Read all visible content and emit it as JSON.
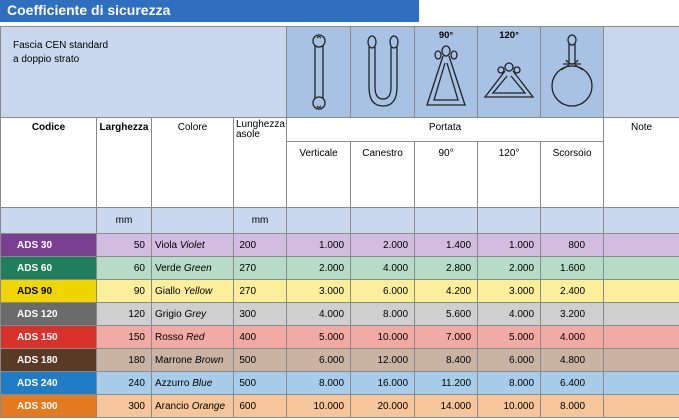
{
  "title": "Coefficiente di sicurezza",
  "headline": [
    "Fascia CEN standard",
    "a doppio strato"
  ],
  "angle_labels": {
    "a90": "90°",
    "a120": "120°"
  },
  "headers": {
    "codice": "Codice",
    "larghezza": "Larghezza",
    "colore": "Colore",
    "lunghezza": [
      "Lunghezza",
      "asole"
    ],
    "portata": "Portata",
    "note": "Note",
    "sub": [
      "Verticale",
      "Canestro",
      "90°",
      "120°",
      "Scorsoio"
    ]
  },
  "units": {
    "larghezza": "mm",
    "lunghezza": "mm"
  },
  "colors": {
    "title_bar": "#2f6fc0",
    "header_blue": "#c9d8ee",
    "icon_blue": "#a8c2e4"
  },
  "rows": [
    {
      "code": "ADS 30",
      "width": "50",
      "color_it": "Viola",
      "color_en": "Violet",
      "length": "200",
      "vert": "1.000",
      "can": "2.000",
      "a90": "1.400",
      "a120": "1.000",
      "scor": "800",
      "code_bg": "#7a3f91",
      "row_bg": "#d2bde0"
    },
    {
      "code": "ADS 60",
      "width": "60",
      "color_it": "Verde",
      "color_en": "Green",
      "length": "270",
      "vert": "2.000",
      "can": "4.000",
      "a90": "2.800",
      "a120": "2.000",
      "scor": "1.600",
      "code_bg": "#1f7f5d",
      "row_bg": "#b4dcc7"
    },
    {
      "code": "ADS 90",
      "width": "90",
      "color_it": "Giallo",
      "color_en": "Yellow",
      "length": "270",
      "vert": "3.000",
      "can": "6.000",
      "a90": "4.200",
      "a120": "3.000",
      "scor": "2.400",
      "code_bg": "#f1d500",
      "row_bg": "#fbef9c"
    },
    {
      "code": "ADS 120",
      "width": "120",
      "color_it": "Grigio",
      "color_en": "Grey",
      "length": "300",
      "vert": "4.000",
      "can": "8.000",
      "a90": "5.600",
      "a120": "4.000",
      "scor": "3.200",
      "code_bg": "#6b6b6b",
      "row_bg": "#cfcfcf"
    },
    {
      "code": "ADS 150",
      "width": "150",
      "color_it": "Rosso",
      "color_en": "Red",
      "length": "400",
      "vert": "5.000",
      "can": "10.000",
      "a90": "7.000",
      "a120": "5.000",
      "scor": "4.000",
      "code_bg": "#d9322a",
      "row_bg": "#f2aaa4"
    },
    {
      "code": "ADS 180",
      "width": "180",
      "color_it": "Marrone",
      "color_en": "Brown",
      "length": "500",
      "vert": "6.000",
      "can": "12.000",
      "a90": "8.400",
      "a120": "6.000",
      "scor": "4.800",
      "code_bg": "#5b3a24",
      "row_bg": "#c9b4a4"
    },
    {
      "code": "ADS 240",
      "width": "240",
      "color_it": "Azzurro",
      "color_en": "Blue",
      "length": "500",
      "vert": "8.000",
      "can": "16.000",
      "a90": "11.200",
      "a120": "8.000",
      "scor": "6.400",
      "code_bg": "#1f7dc8",
      "row_bg": "#a8cdea"
    },
    {
      "code": "ADS 300",
      "width": "300",
      "color_it": "Arancio",
      "color_en": "Orange",
      "length": "600",
      "vert": "10.000",
      "can": "20.000",
      "a90": "14.000",
      "a120": "10.000",
      "scor": "8.000",
      "code_bg": "#e47a1f",
      "row_bg": "#f6c59a"
    }
  ]
}
